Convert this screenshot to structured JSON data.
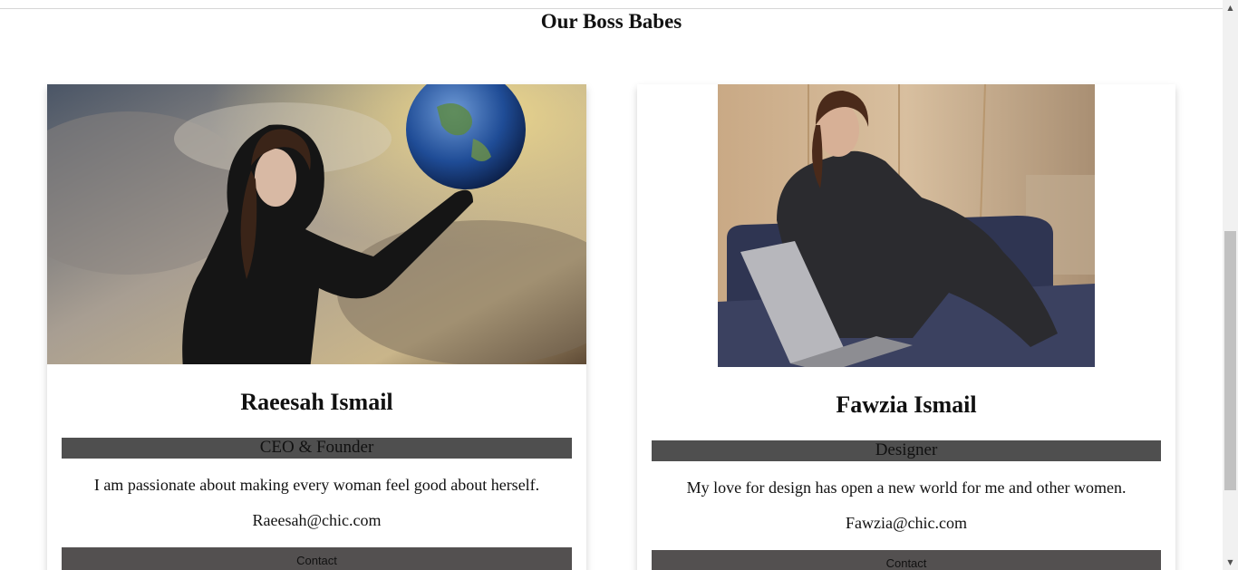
{
  "section": {
    "title": "Our Boss Babes"
  },
  "cards": [
    {
      "name": "Raeesah Ismail",
      "role": "CEO & Founder",
      "description": "I am passionate about making every woman feel good about herself.",
      "email": "Raeesah@chic.com",
      "contact_label": "Contact"
    },
    {
      "name": "Fawzia Ismail",
      "role": "Designer",
      "description": "My love for design has open a new world for me and other women.",
      "email": "Fawzia@chic.com",
      "contact_label": "Contact"
    }
  ],
  "scrollbar": {
    "up_icon": "triangle-up",
    "down_icon": "triangle-down"
  }
}
